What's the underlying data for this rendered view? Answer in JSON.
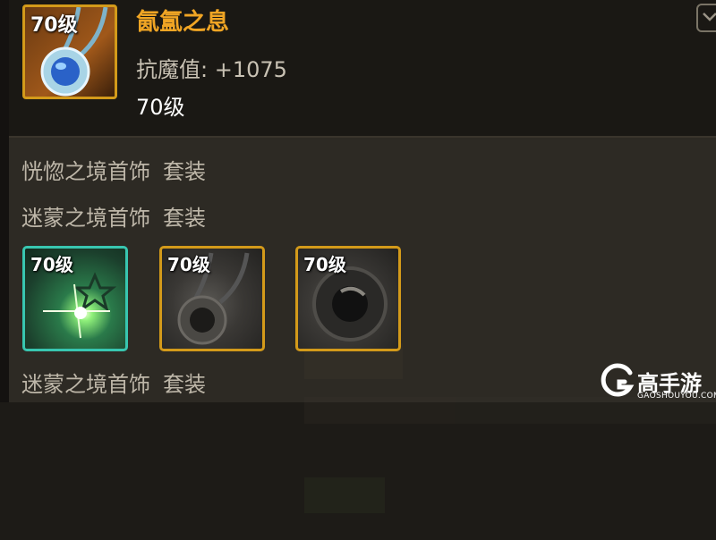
{
  "item": {
    "level": "70级",
    "name": "氤氲之息",
    "stat_label": "抗魔值:",
    "stat_value": "+1075",
    "requirement": "70级"
  },
  "sets": [
    {
      "name": "恍惚之境首饰",
      "suffix": "套装"
    },
    {
      "name": "迷蒙之境首饰",
      "suffix": "套装"
    },
    {
      "name": "迷蒙之境首饰",
      "suffix": "套装"
    }
  ],
  "set_pieces": [
    {
      "level": "70级",
      "icon": "gem-glow-icon",
      "border_color": "#38c6b0"
    },
    {
      "level": "70级",
      "icon": "necklace-icon",
      "border_color": "#d39a1a"
    },
    {
      "level": "70级",
      "icon": "ring-icon",
      "border_color": "#d39a1a"
    }
  ],
  "watermark": {
    "brand": "高手游",
    "url": "GAOSHOUYOU.COM"
  },
  "colors": {
    "item_name": "#f0a524",
    "rarity_border": "#d39a1a",
    "set_text": "#bdb6a8"
  }
}
